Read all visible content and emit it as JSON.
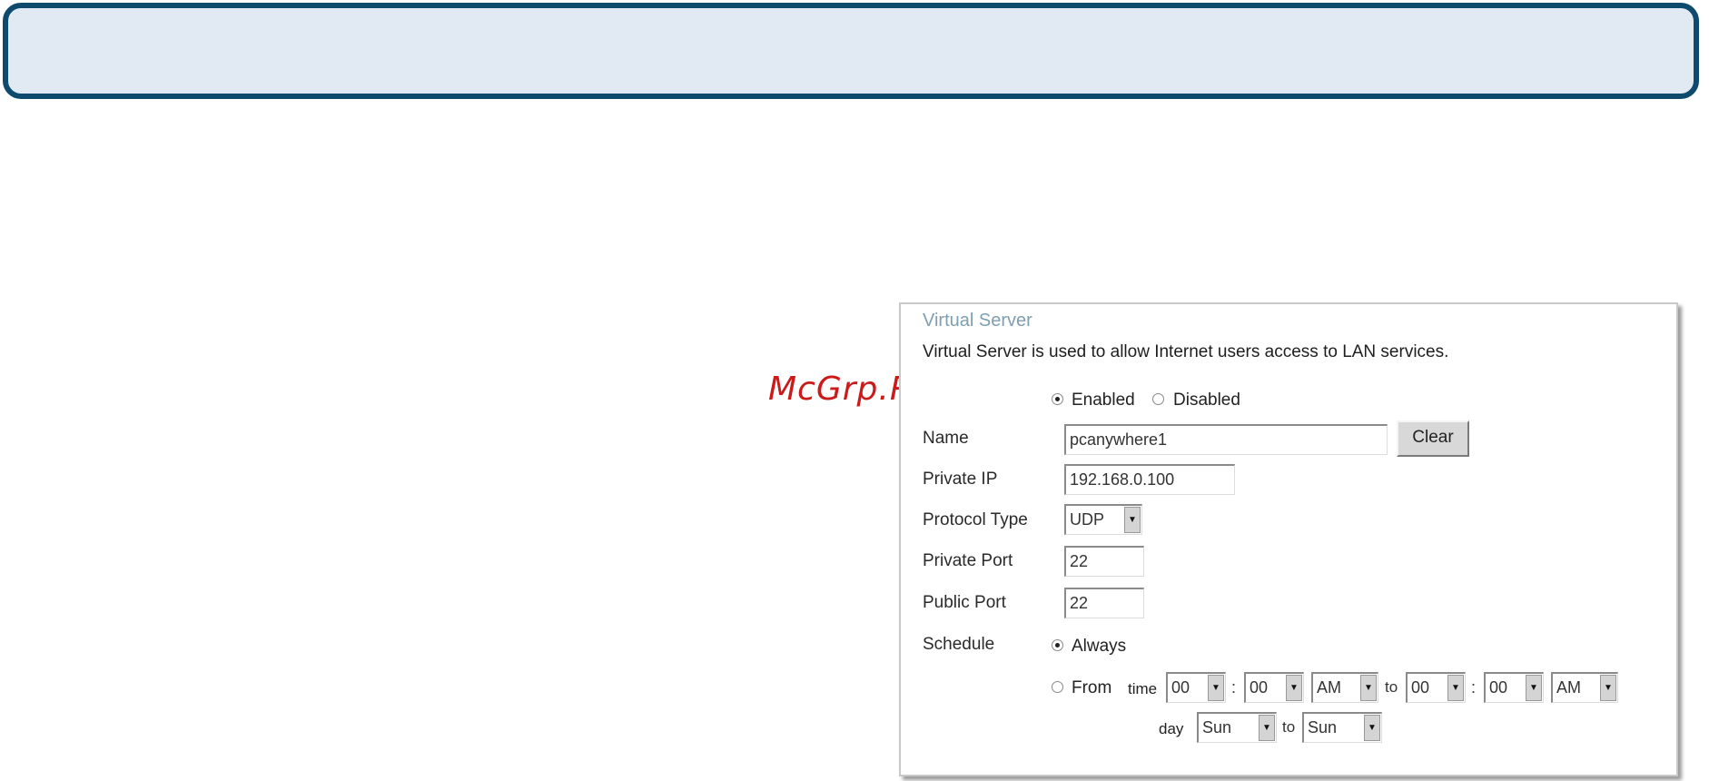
{
  "watermark": "McGrp.Ru",
  "panel": {
    "title": "Virtual Server",
    "description": "Virtual Server is used to allow Internet users access to LAN services."
  },
  "status": {
    "selected": "Enabled",
    "enabled_label": "Enabled",
    "disabled_label": "Disabled"
  },
  "form": {
    "name_label": "Name",
    "name_value": "pcanywhere1",
    "clear_label": "Clear",
    "private_ip_label": "Private IP",
    "private_ip_value": "192.168.0.100",
    "protocol_label": "Protocol Type",
    "protocol_value": "UDP",
    "private_port_label": "Private Port",
    "private_port_value": "22",
    "public_port_label": "Public Port",
    "public_port_value": "22"
  },
  "schedule": {
    "label": "Schedule",
    "selected": "Always",
    "always_label": "Always",
    "from_label": "From",
    "time_label": "time",
    "time_sep": ":",
    "to_label": "to",
    "day_label": "day",
    "start_hour": "00",
    "start_minute": "00",
    "start_ampm": "AM",
    "end_hour": "00",
    "end_minute": "00",
    "end_ampm": "AM",
    "start_day": "Sun",
    "end_day": "Sun"
  },
  "icons": {
    "dropdown": "chevron-down-icon"
  },
  "colors": {
    "header_border": "#0d4a6e",
    "header_fill": "#e1e9f3",
    "panel_title": "#7e9fb1",
    "watermark": "#cc1a1a"
  }
}
